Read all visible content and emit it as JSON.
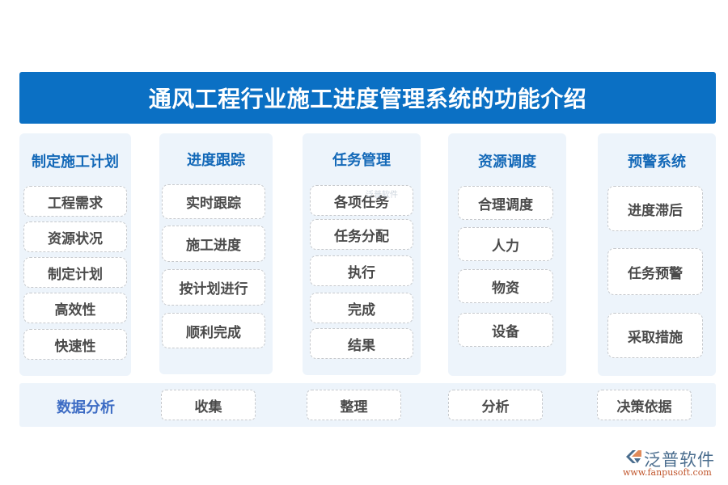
{
  "title": "通风工程行业施工进度管理系统的功能介绍",
  "columns": [
    {
      "heading": "制定施工计划",
      "items": [
        "工程需求",
        "资源状况",
        "制定计划",
        "高效性",
        "快速性"
      ]
    },
    {
      "heading": "进度跟踪",
      "items": [
        "实时跟踪",
        "施工进度",
        "按计划进行",
        "顺利完成"
      ]
    },
    {
      "heading": "任务管理",
      "items": [
        "各项任务",
        "任务分配",
        "执行",
        "完成",
        "结果"
      ]
    },
    {
      "heading": "资源调度",
      "items": [
        "合理调度",
        "人力",
        "物资",
        "设备"
      ]
    },
    {
      "heading": "预警系统",
      "items": [
        "进度滞后",
        "任务预警",
        "采取措施"
      ]
    }
  ],
  "bottom": {
    "label": "数据分析",
    "items": [
      "收集",
      "整理",
      "分析",
      "决策依据"
    ]
  },
  "watermark": "泛普软件",
  "logo": {
    "name": "泛普软件",
    "url": "www.fanpusoft.com"
  },
  "colors": {
    "title_bg": "#0b70c4",
    "heading": "#1469b8",
    "panel_bg": "#edf4fb",
    "logo_accent": "#c0552b"
  }
}
